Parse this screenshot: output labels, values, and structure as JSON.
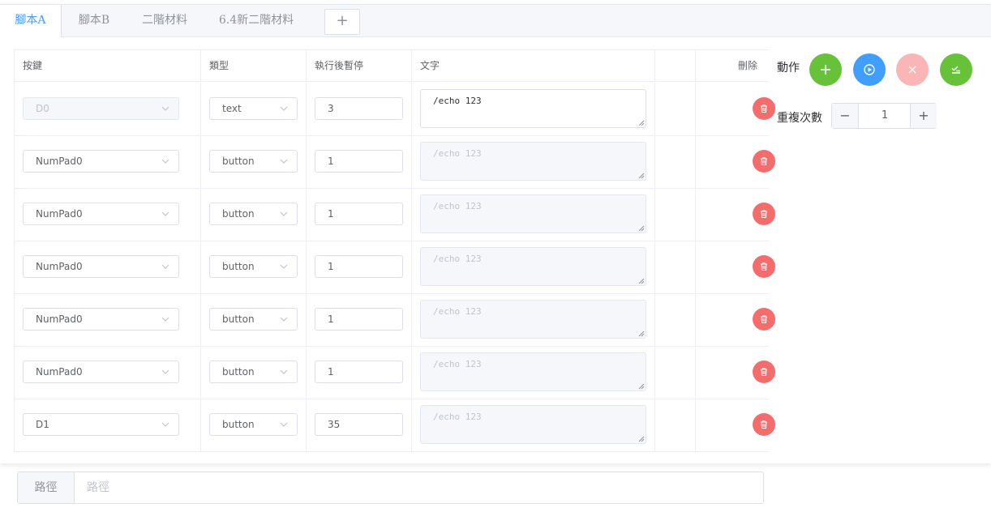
{
  "tabs": [
    {
      "label": "腳本A",
      "active": true
    },
    {
      "label": "腳本B",
      "active": false
    },
    {
      "label": "二階材料",
      "active": false
    },
    {
      "label": "6.4新二階材料",
      "active": false
    }
  ],
  "tab_add_label": "+",
  "table": {
    "headers": {
      "key": "按鍵",
      "type": "類型",
      "pause": "執行後暫停",
      "text": "文字",
      "delete": "刪除"
    },
    "rows": [
      {
        "key": "D0",
        "key_disabled": true,
        "type": "text",
        "pause": "3",
        "text": "/echo 123",
        "text_disabled": false
      },
      {
        "key": "NumPad0",
        "key_disabled": false,
        "type": "button",
        "pause": "1",
        "text": "/echo 123",
        "text_disabled": true
      },
      {
        "key": "NumPad0",
        "key_disabled": false,
        "type": "button",
        "pause": "1",
        "text": "/echo 123",
        "text_disabled": true
      },
      {
        "key": "NumPad0",
        "key_disabled": false,
        "type": "button",
        "pause": "1",
        "text": "/echo 123",
        "text_disabled": true
      },
      {
        "key": "NumPad0",
        "key_disabled": false,
        "type": "button",
        "pause": "1",
        "text": "/echo 123",
        "text_disabled": true
      },
      {
        "key": "NumPad0",
        "key_disabled": false,
        "type": "button",
        "pause": "1",
        "text": "/echo 123",
        "text_disabled": true
      },
      {
        "key": "D1",
        "key_disabled": false,
        "type": "button",
        "pause": "35",
        "text": "/echo 123",
        "text_disabled": true
      }
    ]
  },
  "actions": {
    "label": "動作",
    "buttons": [
      {
        "name": "add",
        "icon": "plus-icon",
        "color": "#67c23a"
      },
      {
        "name": "play",
        "icon": "play-circle-icon",
        "color": "#409eff"
      },
      {
        "name": "stop",
        "icon": "close-icon",
        "color": "#fab6b6"
      },
      {
        "name": "finish",
        "icon": "finished-icon",
        "color": "#67c23a"
      }
    ]
  },
  "repeat": {
    "label": "重複次數",
    "value": "1",
    "minus": "−",
    "plus": "+"
  },
  "path": {
    "label": "路徑",
    "placeholder": "路徑"
  },
  "colors": {
    "accent": "#409eff",
    "success": "#67c23a",
    "danger": "#f56c6c"
  }
}
